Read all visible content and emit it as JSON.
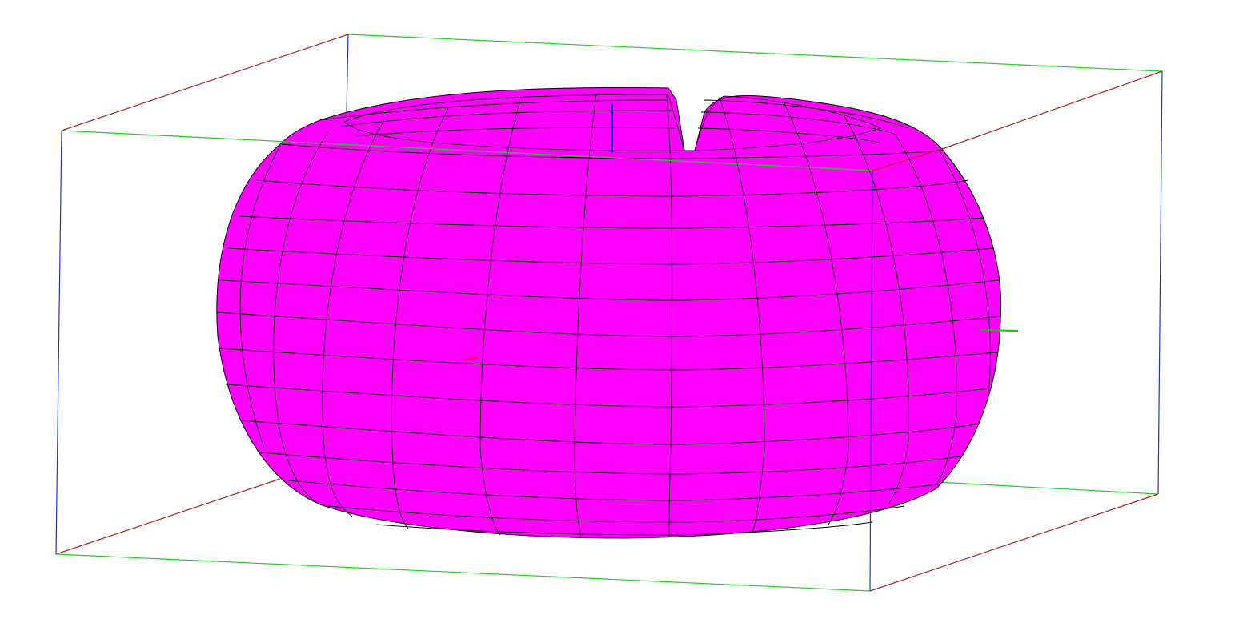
{
  "scene": {
    "background": "#ffffff",
    "surface_color": "#ff00ff",
    "mesh_line_color": "#000000",
    "shape": "torus-with-gap",
    "bounding_box_colors": {
      "x_axis": "#b22222",
      "y_axis": "#22cc22",
      "z_axis": "#2233cc"
    },
    "axis_triad_colors": {
      "x": "#ff0000",
      "y": "#00cc00",
      "z": "#0000ff"
    }
  }
}
